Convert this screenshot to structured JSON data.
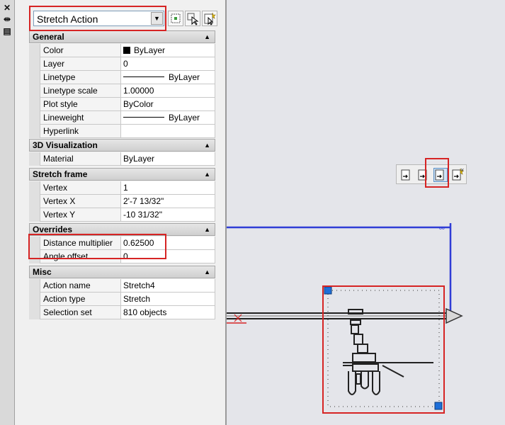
{
  "palette": {
    "type_select": {
      "value": "Stretch Action"
    },
    "strip": {
      "close_glyph": "✕",
      "autohide_glyph": "⇹",
      "menu_glyph": "▤"
    },
    "toolbar_icons": [
      "quick-select-icon",
      "select-objects-icon",
      "toggle-pickadd-icon"
    ],
    "collapse_glyph": "▲",
    "categories": [
      {
        "title": "General",
        "rows": [
          {
            "name": "Color",
            "value": "ByLayer",
            "swatch": true
          },
          {
            "name": "Layer",
            "value": "0"
          },
          {
            "name": "Linetype",
            "value": "ByLayer",
            "linesample": true
          },
          {
            "name": "Linetype scale",
            "value": "1.00000"
          },
          {
            "name": "Plot style",
            "value": "ByColor"
          },
          {
            "name": "Lineweight",
            "value": "ByLayer",
            "linesample": true
          },
          {
            "name": "Hyperlink",
            "value": ""
          }
        ]
      },
      {
        "title": "3D Visualization",
        "rows": [
          {
            "name": "Material",
            "value": "ByLayer"
          }
        ]
      },
      {
        "title": "Stretch frame",
        "rows": [
          {
            "name": "Vertex",
            "value": "1"
          },
          {
            "name": "Vertex X",
            "value": "2'-7 13/32\""
          },
          {
            "name": "Vertex Y",
            "value": "-10 31/32\""
          }
        ]
      },
      {
        "title": "Overrides",
        "rows": [
          {
            "name": "Distance multiplier",
            "value": "0.62500"
          },
          {
            "name": "Angle offset",
            "value": "0"
          }
        ]
      },
      {
        "title": "Misc",
        "rows": [
          {
            "name": "Action name",
            "value": "Stretch4"
          },
          {
            "name": "Action type",
            "value": "Stretch"
          },
          {
            "name": "Selection set",
            "value": "810 objects"
          }
        ]
      }
    ]
  },
  "mini_toolbar": {
    "icons": [
      "action-select-icon",
      "action-add-icon",
      "action-remove-icon",
      "action-new-selection-icon"
    ],
    "active_index": 2,
    "close_glyph": "×"
  },
  "colors": {
    "highlight": "#d62424",
    "parameter_line": "#2f3dd6",
    "grip": "#1e6fd9",
    "canvas": "#e4e5ea"
  }
}
